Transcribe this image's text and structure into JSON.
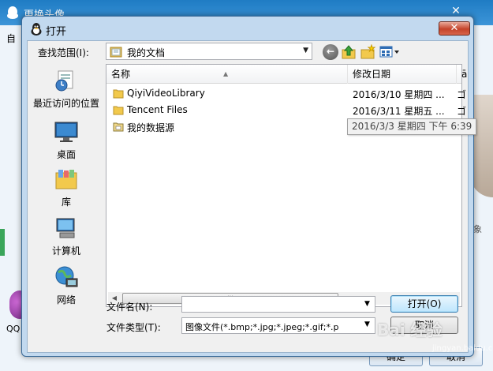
{
  "background_window": {
    "title": "更换头像",
    "left_label": "自",
    "qq_label": "QQ",
    "confirm_label": "确定",
    "cancel_label": "取消",
    "side_char": "象"
  },
  "dialog": {
    "title": "打开",
    "close_label": "✕",
    "lookin": {
      "label": "查找范围(I):",
      "value": "我的文档"
    },
    "places": [
      {
        "label": "最近访问的位置",
        "icon": "recent-places-icon"
      },
      {
        "label": "桌面",
        "icon": "desktop-icon"
      },
      {
        "label": "库",
        "icon": "library-icon"
      },
      {
        "label": "计算机",
        "icon": "computer-icon"
      },
      {
        "label": "网络",
        "icon": "network-icon"
      }
    ],
    "columns": {
      "name": "名称",
      "date": "修改日期",
      "extra": "ā"
    },
    "files": [
      {
        "name": "QiyiVideoLibrary",
        "date": "2016/3/10 星期四 ...",
        "extra": "ゴ",
        "icon": "folder-icon"
      },
      {
        "name": "Tencent Files",
        "date": "2016/3/11 星期五 ...",
        "extra": "ゴ",
        "icon": "folder-icon"
      },
      {
        "name": "我的数据源",
        "date": "",
        "extra": "ゴ",
        "icon": "data-source-folder-icon"
      }
    ],
    "tooltip": "2016/3/3 星期四 下午 6:39",
    "filename_label": "文件名(N):",
    "filename_value": "",
    "filetype_label": "文件类型(T):",
    "filetype_value": "图像文件(*.bmp;*.jpg;*.jpeg;*.gif;*.p",
    "open_label": "打开(O)",
    "cancel_label": "取消"
  },
  "watermark": {
    "main": "Bai 经验",
    "sub": "jingyan.baidu.com"
  }
}
